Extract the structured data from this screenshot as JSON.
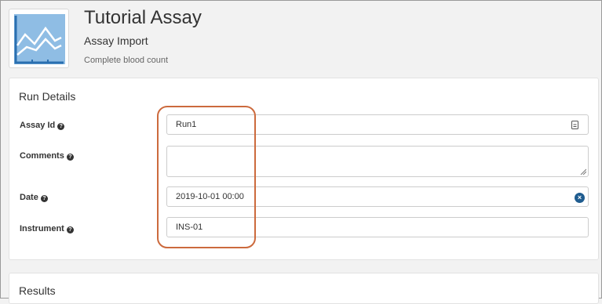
{
  "header": {
    "title": "Tutorial Assay",
    "subtitle": "Assay Import",
    "description": "Complete blood count",
    "icon": "assay-chart-icon"
  },
  "run_details": {
    "title": "Run Details",
    "fields": {
      "assay_id": {
        "label": "Assay Id",
        "value": "Run1"
      },
      "comments": {
        "label": "Comments",
        "value": ""
      },
      "date": {
        "label": "Date",
        "value": "2019-10-01 00:00"
      },
      "instrument": {
        "label": "Instrument",
        "value": "INS-01"
      }
    }
  },
  "results": {
    "title": "Results"
  },
  "colors": {
    "annotation": "#cc6a3d",
    "clear_button": "#1f5c8f",
    "icon_fill": "#8fbde4",
    "icon_frame": "#2a6fb0"
  }
}
